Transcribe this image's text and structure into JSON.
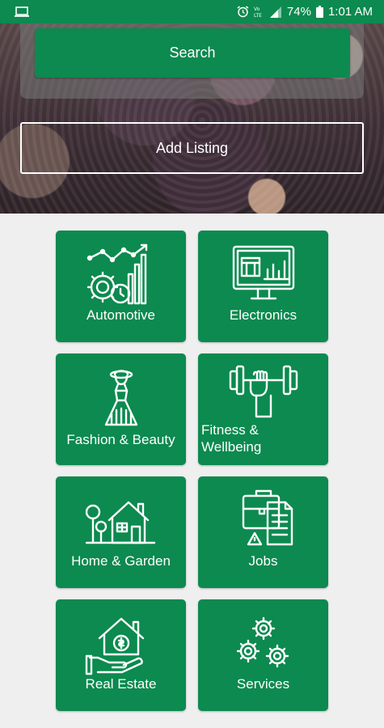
{
  "status_bar": {
    "battery": "74%",
    "time": "1:01 AM"
  },
  "hero": {
    "search_label": "Search",
    "add_listing_label": "Add Listing"
  },
  "categories": [
    {
      "label": "Automotive",
      "icon": "automotive-icon"
    },
    {
      "label": "Electronics",
      "icon": "electronics-icon"
    },
    {
      "label": "Fashion & Beauty",
      "icon": "fashion-icon"
    },
    {
      "label": "Fitness &\nWellbeing",
      "icon": "fitness-icon"
    },
    {
      "label": "Home & Garden",
      "icon": "home-garden-icon"
    },
    {
      "label": "Jobs",
      "icon": "jobs-icon"
    },
    {
      "label": "Real Estate",
      "icon": "real-estate-icon"
    },
    {
      "label": "Services",
      "icon": "services-icon"
    }
  ],
  "colors": {
    "primary_green": "#0c8a4f",
    "background": "#efefef"
  }
}
